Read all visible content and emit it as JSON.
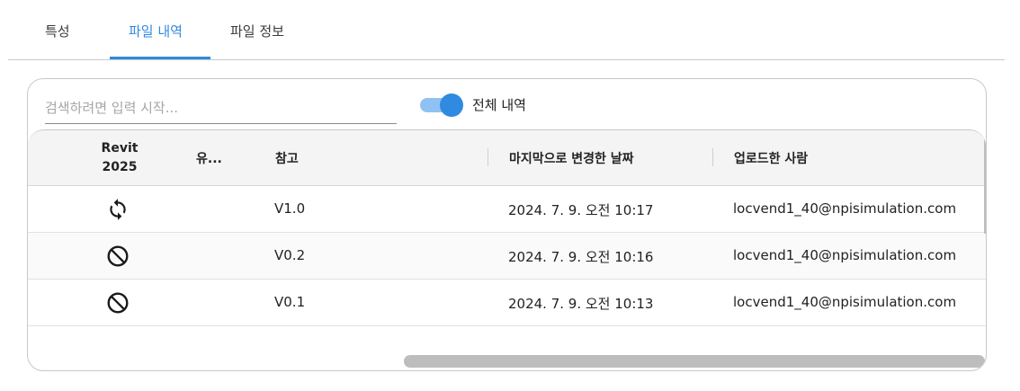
{
  "tabs": [
    {
      "label": "특성"
    },
    {
      "label": "파일 내역"
    },
    {
      "label": "파일 정보"
    }
  ],
  "active_tab": "파일 내역",
  "accent_color": "#2f8ae0",
  "toolbar": {
    "search_placeholder": "검색하려면 입력 시작...",
    "search_value": "",
    "toggle_on": true,
    "toggle_label": "전체 내역"
  },
  "table": {
    "columns": {
      "revit": "Revit\n2025",
      "type": "유...",
      "notes": "참고",
      "date": "마지막으로 변경한 날짜",
      "user": "업로드한 사람"
    },
    "rows": [
      {
        "icon": "sync-icon",
        "version": "V1.0",
        "date": "2024. 7. 9. 오전 10:17",
        "user": "locvend1_40@npisimulation.com"
      },
      {
        "icon": "prohibited-icon",
        "version": "V0.2",
        "date": "2024. 7. 9. 오전 10:16",
        "user": "locvend1_40@npisimulation.com"
      },
      {
        "icon": "prohibited-icon",
        "version": "V0.1",
        "date": "2024. 7. 9. 오전 10:13",
        "user": "locvend1_40@npisimulation.com"
      }
    ]
  }
}
